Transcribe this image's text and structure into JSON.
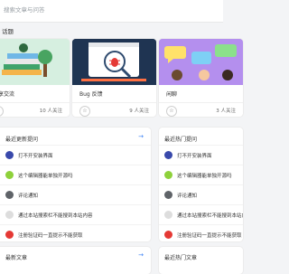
{
  "search": {
    "placeholder": "搜索文章与问答"
  },
  "section": {
    "title": "话题"
  },
  "topics": [
    {
      "name": "分享交流",
      "followers": "10 人关注"
    },
    {
      "name": "Bug 反馈",
      "followers": "9 人关注"
    },
    {
      "name": "闲聊",
      "followers": "3 人关注"
    }
  ],
  "panels": {
    "questions": {
      "title": "最近更新提问",
      "items": [
        "打不开安装界面",
        "这个编辑器能单独开源吗",
        "评论通知",
        "通过本站搜索栏不能搜到本站内容",
        "注册验证码一直提示不能获取"
      ]
    },
    "hot_questions": {
      "title": "最近热门提问",
      "items": [
        "打不开安装界面",
        "这个编辑器能单独开源吗",
        "评论通知",
        "通过本站搜索栏不能搜到本站内容",
        "注册验证码一直提示不能获取"
      ]
    },
    "articles": {
      "title": "最新文章"
    },
    "hot_articles": {
      "title": "最近热门文章"
    }
  },
  "colors": {
    "accent": "#3b82f6",
    "avatar1": "#3949ab",
    "avatar2": "#8ed13b",
    "avatar3": "#5f6368",
    "avatar4": "#dddddd",
    "avatar5": "#e53935"
  }
}
